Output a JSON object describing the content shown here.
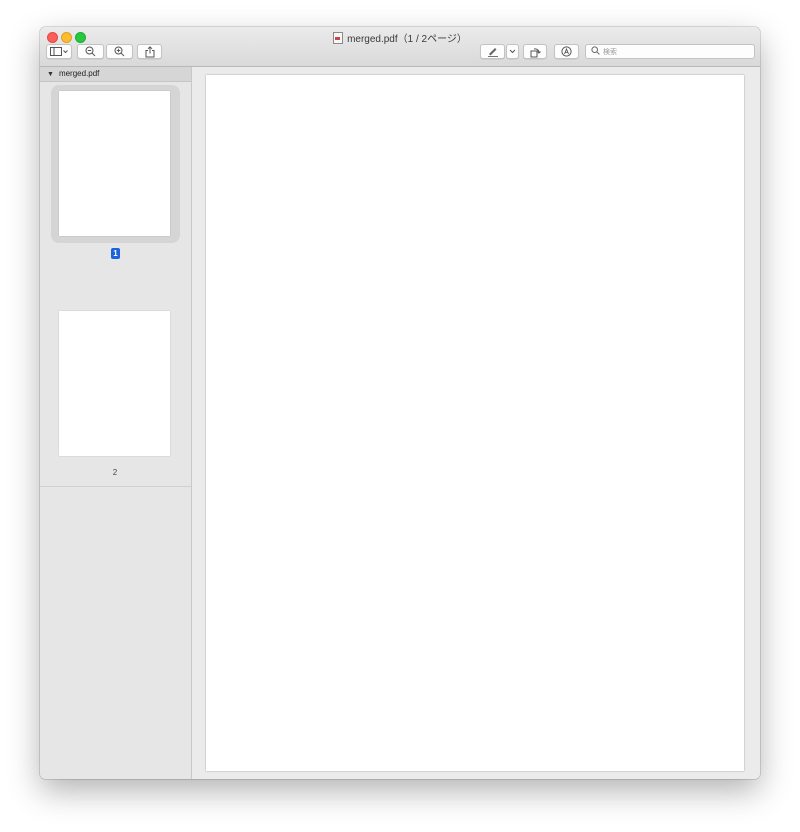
{
  "window": {
    "title": "merged.pdf（1 / 2ページ）",
    "traffic_lights": [
      "close",
      "minimize",
      "maximize"
    ]
  },
  "toolbar": {
    "sidebar_toggle_icon": "sidebar-icon",
    "sidebar_menu_icon": "chevron-down-icon",
    "zoom_out_icon": "zoom-out-icon",
    "zoom_in_icon": "zoom-in-icon",
    "share_icon": "share-icon",
    "markup_pen_icon": "pen-icon",
    "markup_menu_icon": "chevron-down-icon",
    "rotate_icon": "rotate-icon",
    "annotate_icon": "markup-icon",
    "search_placeholder": "検索"
  },
  "sidebar": {
    "document_name": "merged.pdf",
    "pages": [
      {
        "label": "1",
        "selected": true
      },
      {
        "label": "2",
        "selected": false
      }
    ]
  },
  "colors": {
    "selected_page_badge": "#1c62dc",
    "close": "#fc5f57",
    "minimize": "#fdbc2e",
    "maximize": "#28c840"
  }
}
